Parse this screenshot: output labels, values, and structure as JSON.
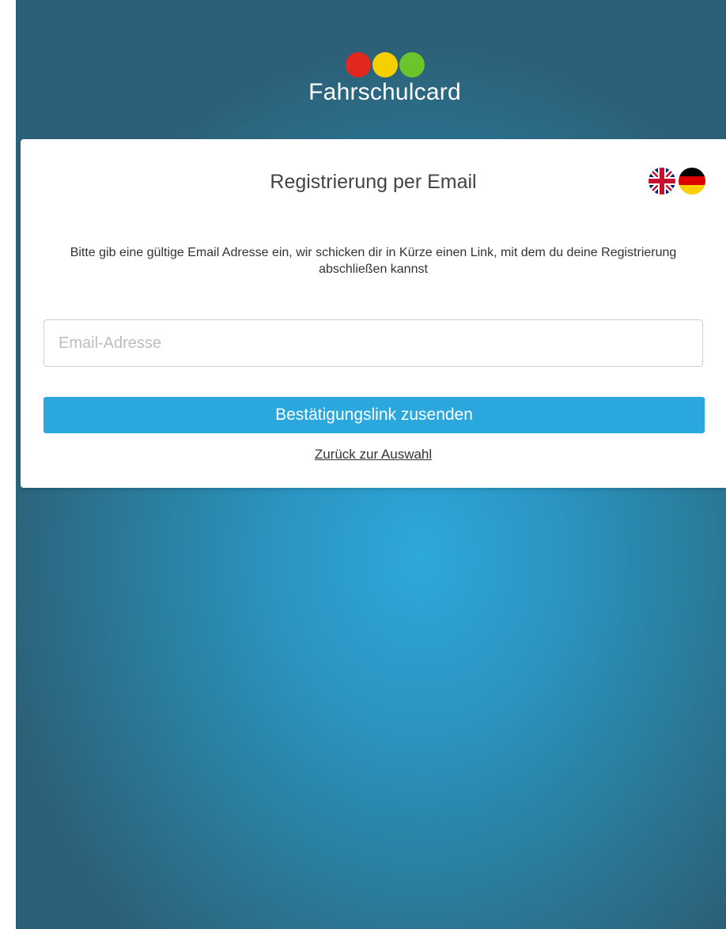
{
  "brand": {
    "name": "Fahrschulcard",
    "dot_colors": [
      "#e0281f",
      "#f5d000",
      "#6cc62b"
    ]
  },
  "card": {
    "title": "Registrierung per Email",
    "description": "Bitte gib eine gültige Email Adresse ein, wir schicken dir in Kürze einen Link, mit dem du deine Registrierung abschließen kannst",
    "email_input": {
      "value": "",
      "placeholder": "Email-Adresse"
    },
    "submit_label": "Bestätigungslink zusenden",
    "back_label": "Zurück zur Auswahl",
    "languages": [
      {
        "code": "en",
        "icon": "uk-flag-icon"
      },
      {
        "code": "de",
        "icon": "german-flag-icon"
      }
    ]
  },
  "colors": {
    "accent": "#2aa7dc",
    "background": "#2a7d9c"
  }
}
